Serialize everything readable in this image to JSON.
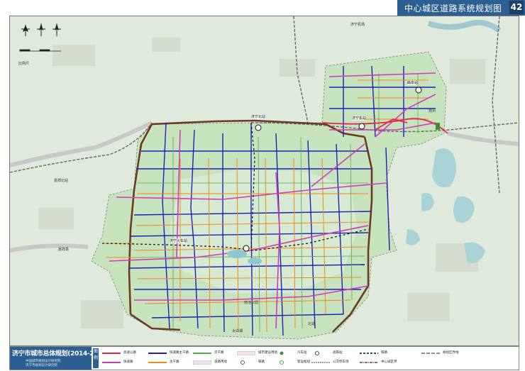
{
  "header": {
    "title": "中心城区道路系统规划图",
    "figure_number": "42"
  },
  "map": {
    "scale_label": "比例尺",
    "icons": [
      "north-arrow-icon",
      "compass-rose-icon",
      "railway-station-icon"
    ],
    "stations": [
      {
        "name": "济宁北站",
        "icon": "railway-station-icon"
      },
      {
        "name": "济宁东站",
        "icon": "railway-station-icon"
      },
      {
        "name": "济宁火车站",
        "icon": "railway-station-icon"
      },
      {
        "name": "曲阜站",
        "icon": "railway-station-icon"
      }
    ],
    "place_labels": [
      "嘉祥北站",
      "嘉祥县",
      "兖州",
      "南池公园",
      "太白湖",
      "北湖",
      "济宁机场"
    ],
    "colors": {
      "base_map": "#dfe9dc",
      "green_zone": "#c7e3bd",
      "water": "#9fd0d8",
      "expressway": "#e8254d",
      "fast_road": "#d23ab9",
      "main_road": "#1f1fb8",
      "secondary_road": "#f08a1a",
      "branch_road": "#5aa84c",
      "boundary": "#6b3a22",
      "railway": "#666666",
      "highway": "#d7d7d7"
    }
  },
  "footer": {
    "plan_title": "济宁市城市总体规划(2014-2030年)",
    "org_lines": [
      "中国城市规划设计研究院",
      "济宁市规划设计研究院"
    ],
    "legend_tag": "图例",
    "legend": [
      {
        "label": "高速公路",
        "symbol": "expressway"
      },
      {
        "label": "快速路",
        "symbol": "fast"
      },
      {
        "label": "快速路主干路",
        "symbol": "main"
      },
      {
        "label": "主干路",
        "symbol": "main2"
      },
      {
        "label": "次干路",
        "symbol": "branch"
      },
      {
        "label": "道路用地",
        "symbol": "road"
      },
      {
        "label": "城市建设用地",
        "symbol": "land"
      },
      {
        "label": "铁路",
        "symbol": "rail"
      },
      {
        "label": "汽车站",
        "symbol": "bus"
      },
      {
        "label": "客运枢纽",
        "symbol": "hub"
      },
      {
        "label": "高铁站",
        "symbol": "hsr"
      },
      {
        "label": "公交停车场",
        "symbol": "depot"
      },
      {
        "label": "铁路",
        "symbol": "rail2"
      },
      {
        "label": "中心城区界",
        "symbol": "cityline"
      },
      {
        "label": "规划区界线",
        "symbol": "planline"
      }
    ]
  }
}
